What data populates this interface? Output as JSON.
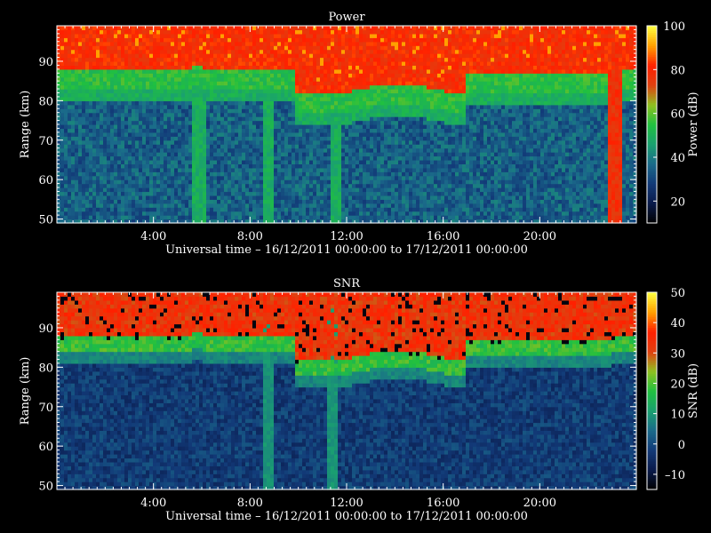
{
  "chart_data": [
    {
      "type": "heatmap",
      "title": "Power",
      "xlabel": "Universal time – 16/12/2011 00:00:00 to 17/12/2011 00:00:00",
      "ylabel": "Range (km)",
      "xlim": [
        0,
        24
      ],
      "ylim": [
        49,
        99
      ],
      "x_ticks": [
        4,
        8,
        12,
        16,
        20
      ],
      "x_tick_labels": [
        "4:00",
        "8:00",
        "12:00",
        "16:00",
        "20:00"
      ],
      "y_ticks": [
        50,
        60,
        70,
        80,
        90
      ],
      "y_tick_labels": [
        "50",
        "60",
        "70",
        "80",
        "90"
      ],
      "colorbar": {
        "label": "Power (dB)",
        "range": [
          10,
          100
        ],
        "ticks": [
          20,
          40,
          60,
          80,
          100
        ],
        "tick_labels": [
          "20",
          "40",
          "60",
          "80",
          "100"
        ]
      },
      "colormap": [
        "#000000",
        "#0a1a4a",
        "#123a78",
        "#1a6a8a",
        "#1aa070",
        "#20c040",
        "#8fc020",
        "#e04010",
        "#ff2000",
        "#ffa000",
        "#ffff40"
      ],
      "grid": false
    },
    {
      "type": "heatmap",
      "title": "SNR",
      "xlabel": "Universal time – 16/12/2011 00:00:00 to 17/12/2011 00:00:00",
      "ylabel": "Range (km)",
      "xlim": [
        0,
        24
      ],
      "ylim": [
        49,
        99
      ],
      "x_ticks": [
        4,
        8,
        12,
        16,
        20
      ],
      "x_tick_labels": [
        "4:00",
        "8:00",
        "12:00",
        "16:00",
        "20:00"
      ],
      "y_ticks": [
        50,
        60,
        70,
        80,
        90
      ],
      "y_tick_labels": [
        "50",
        "60",
        "70",
        "80",
        "90"
      ],
      "colorbar": {
        "label": "SNR (dB)",
        "range": [
          -15,
          50
        ],
        "ticks": [
          -10,
          0,
          10,
          20,
          30,
          40,
          50
        ],
        "tick_labels": [
          "–10",
          "0",
          "10",
          "20",
          "30",
          "40",
          "50"
        ]
      },
      "colormap": [
        "#000000",
        "#0a1a4a",
        "#123a78",
        "#1a6a8a",
        "#1aa070",
        "#20c040",
        "#8fc020",
        "#e04010",
        "#ff2000",
        "#ffa000",
        "#ffff40"
      ],
      "grid": false
    }
  ]
}
